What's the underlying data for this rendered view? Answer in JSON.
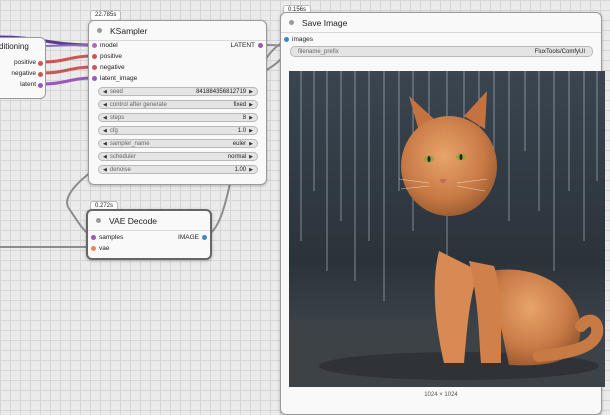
{
  "conditioning_node": {
    "title": "ditioning",
    "outputs": [
      "positive",
      "negative",
      "latent"
    ]
  },
  "ksampler": {
    "timing": "22.785s",
    "title": "KSampler",
    "inputs": [
      "model",
      "positive",
      "negative",
      "latent_image"
    ],
    "output": "LATENT",
    "widgets": [
      {
        "label": "seed",
        "value": "841884356812719"
      },
      {
        "label": "control after generate",
        "value": "fixed"
      },
      {
        "label": "steps",
        "value": "8"
      },
      {
        "label": "cfg",
        "value": "1.0"
      },
      {
        "label": "sampler_name",
        "value": "euler"
      },
      {
        "label": "scheduler",
        "value": "normal"
      },
      {
        "label": "denoise",
        "value": "1.00"
      }
    ]
  },
  "vae_decode": {
    "timing": "0.272s",
    "title": "VAE Decode",
    "inputs": [
      "samples",
      "vae"
    ],
    "output": "IMAGE"
  },
  "save_image": {
    "timing": "0.156s",
    "title": "Save Image",
    "input": "images",
    "widget": {
      "label": "filename_prefix",
      "value": "FluxTools/ComfyUI"
    },
    "image_caption": "1024 × 1024"
  },
  "colors": {
    "model": "#a86fb8",
    "conditioning": "#c95757",
    "latent": "#9b59b6",
    "image": "#3d88c7",
    "vae": "#e3895a"
  }
}
